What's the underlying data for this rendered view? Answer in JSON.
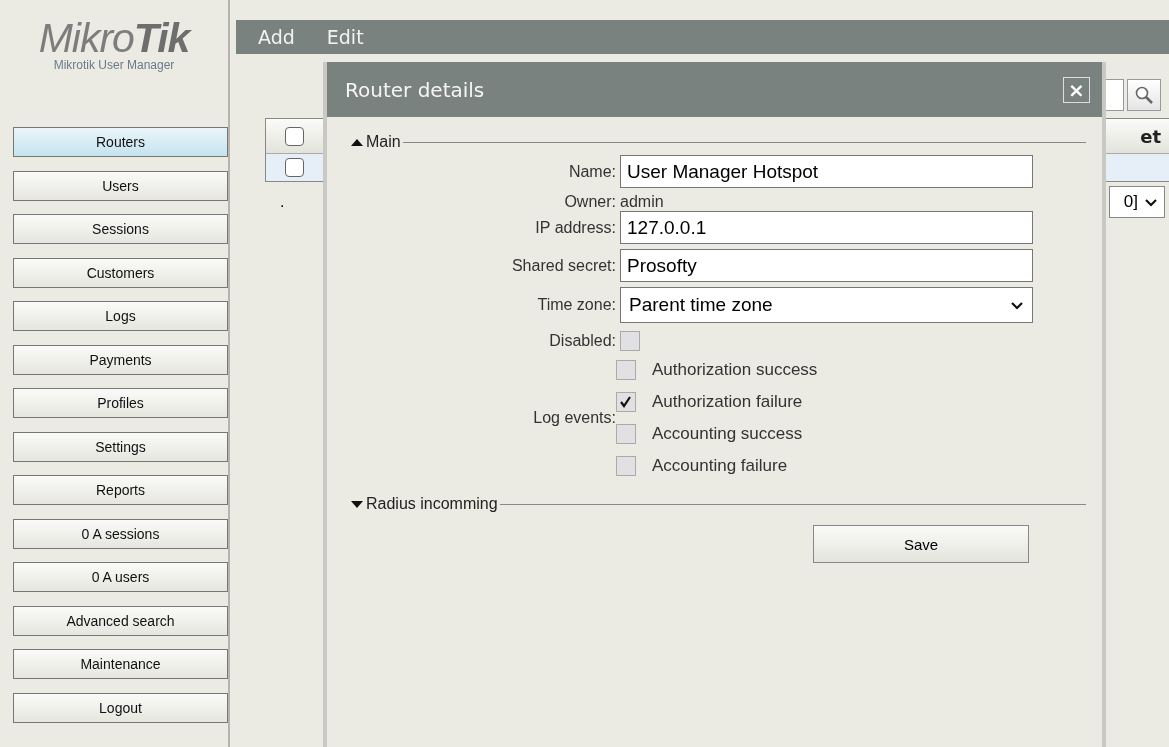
{
  "logo": {
    "light": "Mikro",
    "bold": "Tik",
    "subtitle": "Mikrotik User Manager"
  },
  "sidebar": {
    "items": [
      {
        "label": "Routers",
        "selected": true
      },
      {
        "label": "Users",
        "selected": false
      },
      {
        "label": "Sessions",
        "selected": false
      },
      {
        "label": "Customers",
        "selected": false
      },
      {
        "label": "Logs",
        "selected": false
      },
      {
        "label": "Payments",
        "selected": false
      },
      {
        "label": "Profiles",
        "selected": false
      },
      {
        "label": "Settings",
        "selected": false
      },
      {
        "label": "Reports",
        "selected": false
      },
      {
        "label": "0 A sessions",
        "selected": false
      },
      {
        "label": "0 A users",
        "selected": false
      },
      {
        "label": "Advanced search",
        "selected": false
      },
      {
        "label": "Maintenance",
        "selected": false
      },
      {
        "label": "Logout",
        "selected": false
      }
    ]
  },
  "toolbar": [
    "Add",
    "Edit"
  ],
  "table": {
    "header": {
      "checked": false,
      "column_2": "et"
    },
    "rows": [
      {
        "checked": false
      }
    ],
    "footer_mark": ".",
    "page_size": "0]"
  },
  "dialog": {
    "title": "Router details",
    "close": "×",
    "sections": [
      {
        "title": "Main",
        "expanded": true,
        "fields": [
          {
            "kind": "input",
            "label": "Name:",
            "value": "User Manager Hotspot"
          },
          {
            "kind": "text",
            "label": "Owner:",
            "value": "admin"
          },
          {
            "kind": "input",
            "label": "IP address:",
            "value": "127.0.0.1"
          },
          {
            "kind": "input",
            "label": "Shared secret:",
            "value": "Prosofty"
          },
          {
            "kind": "select",
            "label": "Time zone:",
            "value": "Parent time zone"
          },
          {
            "kind": "checkbox",
            "label": "Disabled:",
            "checked": false
          },
          {
            "kind": "checklist",
            "label": "Log events:",
            "options": [
              {
                "label": "Authorization success",
                "checked": false
              },
              {
                "label": "Authorization failure",
                "checked": true
              },
              {
                "label": "Accounting success",
                "checked": false
              },
              {
                "label": "Accounting failure",
                "checked": false
              }
            ]
          }
        ]
      },
      {
        "title": "Radius incomming",
        "expanded": false
      }
    ],
    "save": "Save"
  }
}
